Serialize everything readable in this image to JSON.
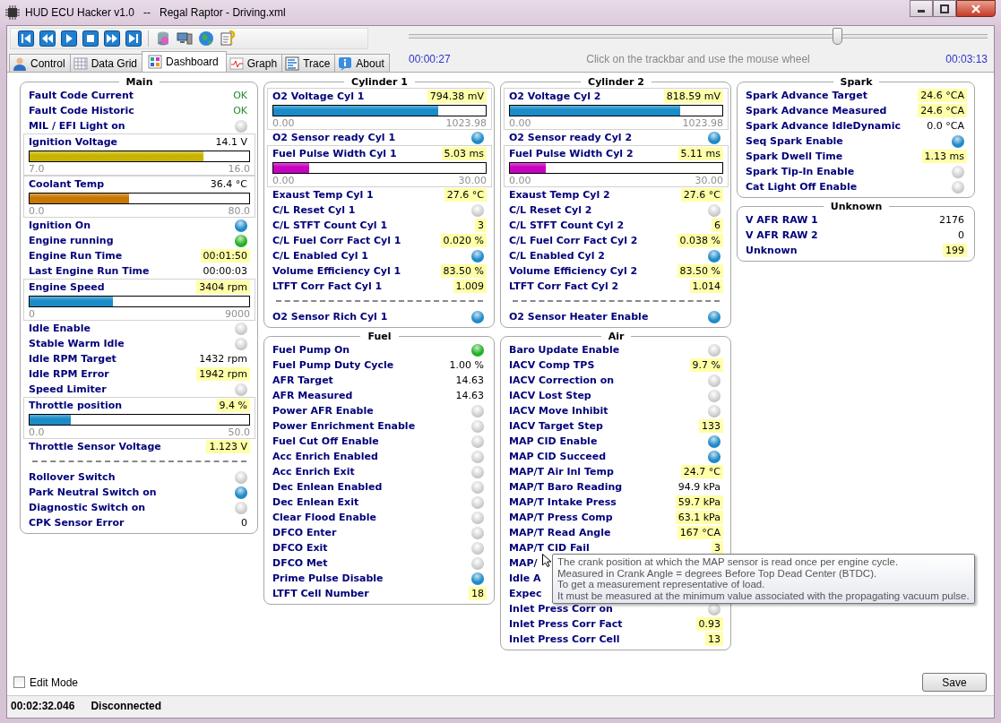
{
  "window": {
    "title": "HUD ECU Hacker v1.0   --   Regal Raptor - Driving.xml"
  },
  "tabs": [
    {
      "label": "Control",
      "selected": false
    },
    {
      "label": "Data Grid",
      "selected": false
    },
    {
      "label": "Dashboard",
      "selected": true
    },
    {
      "label": "Graph",
      "selected": false
    },
    {
      "label": "Trace",
      "selected": false
    },
    {
      "label": "About",
      "selected": false
    }
  ],
  "trackbar": {
    "level": 0.74,
    "start_time": "00:00:27",
    "hint": "Click on the trackbar and use the mouse wheel",
    "end_time": "00:03:13"
  },
  "columns": [
    {
      "panels": [
        {
          "title": "Main",
          "rows": [
            {
              "kind": "status",
              "label": "Fault Code Current",
              "value": "OK"
            },
            {
              "kind": "status",
              "label": "Fault Code Historic",
              "value": "OK"
            },
            {
              "kind": "led",
              "label": "MIL / EFI Light on",
              "lit": false
            },
            {
              "kind": "gauge",
              "label": "Ignition Voltage",
              "value": "14.1 V",
              "highlighted": false,
              "min": "7.0",
              "max": "16.0",
              "level": 0.79,
              "color": "#c8b400"
            },
            {
              "kind": "gauge",
              "label": "Coolant Temp",
              "value": "36.4 °C",
              "highlighted": false,
              "min": "0.0",
              "max": "80.0",
              "level": 0.455,
              "color": "#c87800"
            },
            {
              "kind": "led",
              "label": "Ignition On",
              "lit": true,
              "color": "#1e8ac8"
            },
            {
              "kind": "led",
              "label": "Engine running",
              "lit": true,
              "color": "#22b022"
            },
            {
              "kind": "value",
              "label": "Engine Run Time",
              "value": "00:01:50",
              "highlighted": true
            },
            {
              "kind": "value",
              "label": "Last Engine Run Time",
              "value": "00:00:03",
              "highlighted": false
            },
            {
              "kind": "gauge",
              "label": "Engine Speed",
              "value": "3404 rpm",
              "highlighted": true,
              "min": "0",
              "max": "9000",
              "level": 0.378,
              "color": "#1a8cc8"
            },
            {
              "kind": "led",
              "label": "Idle Enable",
              "lit": false
            },
            {
              "kind": "led",
              "label": "Stable Warm Idle",
              "lit": false
            },
            {
              "kind": "value",
              "label": "Idle RPM Target",
              "value": "1432 rpm",
              "highlighted": false
            },
            {
              "kind": "value",
              "label": "Idle RPM Error",
              "value": "1942 rpm",
              "highlighted": true
            },
            {
              "kind": "led",
              "label": "Speed Limiter",
              "lit": false
            },
            {
              "kind": "gauge",
              "label": "Throttle position",
              "value": "9.4 %",
              "highlighted": true,
              "min": "0.0",
              "max": "50.0",
              "level": 0.188,
              "color": "#1a8cc8"
            },
            {
              "kind": "value",
              "label": "Throttle Sensor Voltage",
              "value": "1.123 V",
              "highlighted": true
            },
            {
              "kind": "divider"
            },
            {
              "kind": "led",
              "label": "Rollover Switch",
              "lit": false
            },
            {
              "kind": "led",
              "label": "Park Neutral Switch on",
              "lit": true,
              "color": "#1e8ac8"
            },
            {
              "kind": "led",
              "label": "Diagnostic Switch on",
              "lit": false
            },
            {
              "kind": "value",
              "label": "CPK Sensor Error",
              "value": "0",
              "highlighted": false
            }
          ]
        }
      ]
    },
    {
      "panels": [
        {
          "title": "Cylinder 1",
          "rows": [
            {
              "kind": "gauge",
              "label": "O2 Voltage Cyl 1",
              "value": "794.38 mV",
              "highlighted": true,
              "min": "0.00",
              "max": "1023.98",
              "level": 0.776,
              "color": "#1a8cc8"
            },
            {
              "kind": "led",
              "label": "O2 Sensor ready Cyl 1",
              "lit": true,
              "color": "#1e8ac8"
            },
            {
              "kind": "gauge",
              "label": "Fuel Pulse Width Cyl 1",
              "value": "5.03 ms",
              "highlighted": true,
              "min": "0.00",
              "max": "30.00",
              "level": 0.168,
              "color": "#c800c0"
            },
            {
              "kind": "value",
              "label": "Exaust Temp Cyl 1",
              "value": "27.6 °C",
              "highlighted": true
            },
            {
              "kind": "led",
              "label": "C/L Reset Cyl 1",
              "lit": false
            },
            {
              "kind": "value",
              "label": "C/L STFT Count Cyl 1",
              "value": "3",
              "highlighted": true
            },
            {
              "kind": "value",
              "label": "C/L Fuel Corr Fact Cyl 1",
              "value": "0.020 %",
              "highlighted": true
            },
            {
              "kind": "led",
              "label": "C/L Enabled Cyl 1",
              "lit": true,
              "color": "#1e8ac8"
            },
            {
              "kind": "value",
              "label": "Volume Efficiency Cyl 1",
              "value": "83.50 %",
              "highlighted": true
            },
            {
              "kind": "value",
              "label": "LTFT Corr Fact Cyl 1",
              "value": "1.009",
              "highlighted": true
            },
            {
              "kind": "divider"
            },
            {
              "kind": "led",
              "label": "O2 Sensor Rich Cyl 1",
              "lit": true,
              "color": "#1e8ac8"
            }
          ]
        },
        {
          "title": "Fuel",
          "rows": [
            {
              "kind": "led",
              "label": "Fuel Pump On",
              "lit": true,
              "color": "#22b022"
            },
            {
              "kind": "value",
              "label": "Fuel Pump Duty Cycle",
              "value": "1.00 %",
              "highlighted": false
            },
            {
              "kind": "value",
              "label": "AFR Target",
              "value": "14.63",
              "highlighted": false
            },
            {
              "kind": "value",
              "label": "AFR Measured",
              "value": "14.63",
              "highlighted": false
            },
            {
              "kind": "led",
              "label": "Power AFR Enable",
              "lit": false
            },
            {
              "kind": "led",
              "label": "Power Enrichment Enable",
              "lit": false
            },
            {
              "kind": "led",
              "label": "Fuel Cut Off Enable",
              "lit": false
            },
            {
              "kind": "led",
              "label": "Acc Enrich Enabled",
              "lit": false
            },
            {
              "kind": "led",
              "label": "Acc Enrich Exit",
              "lit": false
            },
            {
              "kind": "led",
              "label": "Dec Enlean Enabled",
              "lit": false
            },
            {
              "kind": "led",
              "label": "Dec Enlean Exit",
              "lit": false
            },
            {
              "kind": "led",
              "label": "Clear Flood Enable",
              "lit": false
            },
            {
              "kind": "led",
              "label": "DFCO Enter",
              "lit": false
            },
            {
              "kind": "led",
              "label": "DFCO Exit",
              "lit": false
            },
            {
              "kind": "led",
              "label": "DFCO Met",
              "lit": false
            },
            {
              "kind": "led",
              "label": "Prime Pulse Disable",
              "lit": true,
              "color": "#1e8ac8"
            },
            {
              "kind": "value",
              "label": "LTFT Cell Number",
              "value": "18",
              "highlighted": true
            }
          ]
        }
      ]
    },
    {
      "panels": [
        {
          "title": "Cylinder 2",
          "rows": [
            {
              "kind": "gauge",
              "label": "O2 Voltage Cyl 2",
              "value": "818.59 mV",
              "highlighted": true,
              "min": "0.00",
              "max": "1023.98",
              "level": 0.8,
              "color": "#1a8cc8"
            },
            {
              "kind": "led",
              "label": "O2 Sensor ready Cyl 2",
              "lit": true,
              "color": "#1e8ac8"
            },
            {
              "kind": "gauge",
              "label": "Fuel Pulse Width Cyl 2",
              "value": "5.11 ms",
              "highlighted": true,
              "min": "0.00",
              "max": "30.00",
              "level": 0.17,
              "color": "#c800c0"
            },
            {
              "kind": "value",
              "label": "Exaust Temp Cyl 2",
              "value": "27.6 °C",
              "highlighted": true
            },
            {
              "kind": "led",
              "label": "C/L Reset Cyl 2",
              "lit": false
            },
            {
              "kind": "value",
              "label": "C/L STFT Count Cyl 2",
              "value": "6",
              "highlighted": true
            },
            {
              "kind": "value",
              "label": "C/L Fuel Corr Fact Cyl 2",
              "value": "0.038 %",
              "highlighted": true
            },
            {
              "kind": "led",
              "label": "C/L Enabled Cyl 2",
              "lit": true,
              "color": "#1e8ac8"
            },
            {
              "kind": "value",
              "label": "Volume Efficiency Cyl 2",
              "value": "83.50 %",
              "highlighted": true
            },
            {
              "kind": "value",
              "label": "LTFT Corr Fact Cyl 2",
              "value": "1.014",
              "highlighted": true
            },
            {
              "kind": "divider"
            },
            {
              "kind": "led",
              "label": "O2 Sensor Heater Enable",
              "lit": true,
              "color": "#1e8ac8"
            }
          ]
        },
        {
          "title": "Air",
          "rows": [
            {
              "kind": "led",
              "label": "Baro Update Enable",
              "lit": false
            },
            {
              "kind": "value",
              "label": "IACV Comp TPS",
              "value": "9.7 %",
              "highlighted": true
            },
            {
              "kind": "led",
              "label": "IACV Correction on",
              "lit": false
            },
            {
              "kind": "led",
              "label": "IACV Lost Step",
              "lit": false
            },
            {
              "kind": "led",
              "label": "IACV Move Inhibit",
              "lit": false
            },
            {
              "kind": "value",
              "label": "IACV Target Step",
              "value": "133",
              "highlighted": true
            },
            {
              "kind": "led",
              "label": "MAP CID Enable",
              "lit": true,
              "color": "#1e8ac8"
            },
            {
              "kind": "led",
              "label": "MAP CID Succeed",
              "lit": true,
              "color": "#1e8ac8"
            },
            {
              "kind": "value",
              "label": "MAP/T Air Inl Temp",
              "value": "24.7 °C",
              "highlighted": true
            },
            {
              "kind": "value",
              "label": "MAP/T Baro Reading",
              "value": "94.9 kPa",
              "highlighted": false
            },
            {
              "kind": "value",
              "label": "MAP/T Intake Press",
              "value": "59.7 kPa",
              "highlighted": true
            },
            {
              "kind": "value",
              "label": "MAP/T Press Comp",
              "value": "63.1 kPa",
              "highlighted": true
            },
            {
              "kind": "value",
              "label": "MAP/T Read Angle",
              "value": "167 °CA",
              "highlighted": true
            },
            {
              "kind": "value",
              "label": "MAP/T CID Fail",
              "value": "3",
              "highlighted": true
            },
            {
              "kind": "text",
              "label": "MAP/",
              "tooltip": [
                "The crank position at which the MAP sensor is read once per engine cycle.",
                "Measured in Crank Angle = degrees Before Top Dead Center (BTDC).",
                "To get a measurement representative of load.",
                "It must be measured at the minimum value associated with the propagating vacuum pulse."
              ]
            },
            {
              "kind": "text",
              "label": "Idle A"
            },
            {
              "kind": "text",
              "label": "Expec"
            },
            {
              "kind": "led",
              "label": "Inlet Press Corr on",
              "lit": false
            },
            {
              "kind": "value",
              "label": "Inlet Press Corr Fact",
              "value": "0.93",
              "highlighted": true
            },
            {
              "kind": "value",
              "label": "Inlet Press Corr Cell",
              "value": "13",
              "highlighted": true
            }
          ]
        }
      ]
    },
    {
      "panels": [
        {
          "title": "Spark",
          "rows": [
            {
              "kind": "value",
              "label": "Spark Advance Target",
              "value": "24.6 °CA",
              "highlighted": true
            },
            {
              "kind": "value",
              "label": "Spark Advance Measured",
              "value": "24.6 °CA",
              "highlighted": true
            },
            {
              "kind": "value",
              "label": "Spark Advance IdleDynamic",
              "value": "0.0 °CA",
              "highlighted": false
            },
            {
              "kind": "led",
              "label": "Seq Spark Enable",
              "lit": true,
              "color": "#1e8ac8"
            },
            {
              "kind": "value",
              "label": "Spark Dwell Time",
              "value": "1.13 ms",
              "highlighted": true
            },
            {
              "kind": "led",
              "label": "Spark Tip-In Enable",
              "lit": false
            },
            {
              "kind": "led",
              "label": "Cat Light Off Enable",
              "lit": false
            }
          ]
        },
        {
          "title": "Unknown",
          "rows": [
            {
              "kind": "value",
              "label": "V AFR RAW 1",
              "value": "2176",
              "highlighted": false
            },
            {
              "kind": "value",
              "label": "V AFR RAW 2",
              "value": "0",
              "highlighted": false
            },
            {
              "kind": "value",
              "label": "Unknown",
              "value": "199",
              "highlighted": true
            }
          ]
        }
      ]
    }
  ],
  "edit_mode": {
    "label": "Edit Mode",
    "checked": false
  },
  "save_button": "Save",
  "status_bar": {
    "elapsed": "00:02:32.046",
    "connection": "Disconnected"
  }
}
